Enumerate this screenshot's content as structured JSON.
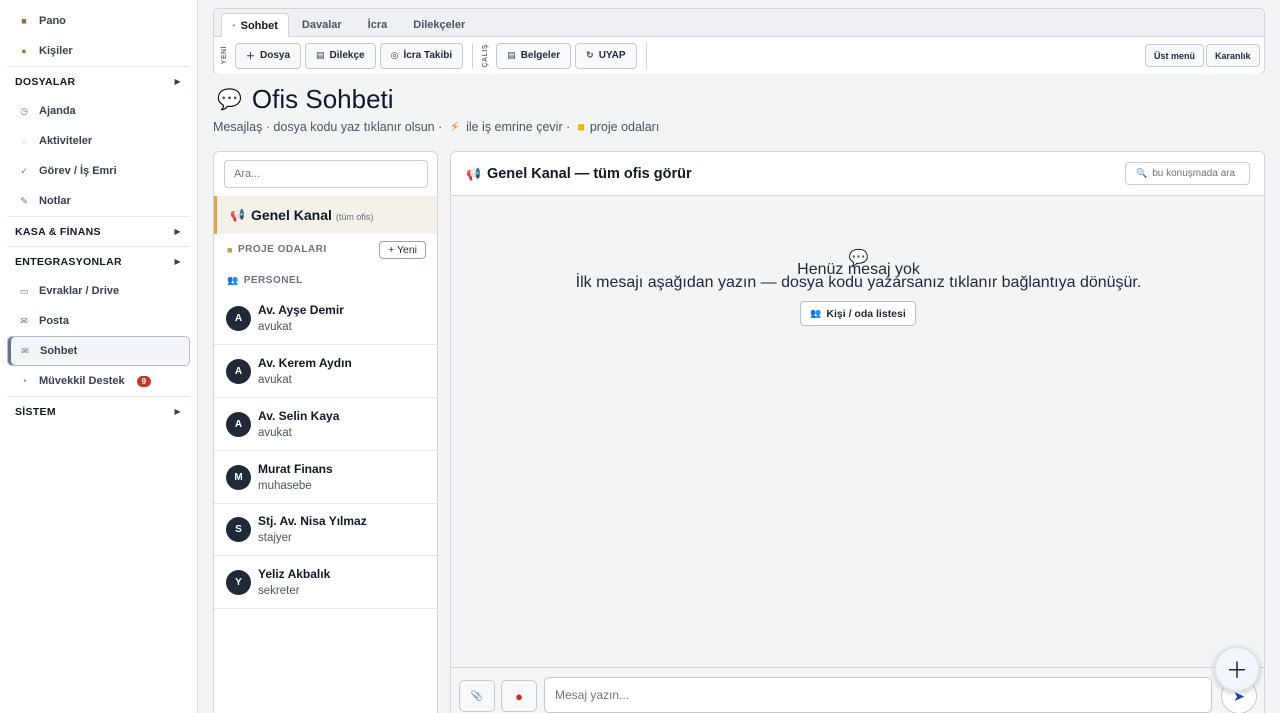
{
  "sidebar": {
    "pano": "Pano",
    "kisiler": "Kişiler",
    "dosyalar": "DOSYALAR",
    "ajanda": "Ajanda",
    "aktiviteler": "Aktiviteler",
    "gorev": "Görev / İş Emri",
    "notlar": "Notlar",
    "kasa": "KASA & FİNANS",
    "entegrasyonlar": "ENTEGRASYONLAR",
    "evraklar": "Evraklar / Drive",
    "posta": "Posta",
    "sohbet": "Sohbet",
    "muvekkil": "Müvekkil Destek",
    "muvekkil_badge": "9",
    "sistem": "SİSTEM"
  },
  "topbar": {
    "tabs": [
      "Sohbet",
      "Davalar",
      "İcra",
      "Dilekçeler"
    ],
    "yeni_label": "YENİ",
    "calis_label": "ÇALIŞ",
    "dosya": "Dosya",
    "dilekce": "Dilekçe",
    "icra_takibi": "İcra Takibi",
    "belgeler": "Belgeler",
    "uyap": "UYAP",
    "ust_menu": "Üst menü",
    "karanlik": "Karanlık"
  },
  "header": {
    "title": "Ofis Sohbeti",
    "sub1": "Mesajlaş · dosya kodu yaz tıklanır olsun ·",
    "sub2": "ile iş emrine çevir ·",
    "sub3": "proje odaları"
  },
  "left": {
    "search_placeholder": "Ara...",
    "genel_name": "Genel Kanal",
    "genel_small": "(tüm ofis)",
    "proje": "PROJE ODALARI",
    "yeni": "+ Yeni",
    "personel": "PERSONEL",
    "people": [
      {
        "initial": "A",
        "name": "Av. Ayşe Demir",
        "role": "avukat"
      },
      {
        "initial": "A",
        "name": "Av. Kerem Aydın",
        "role": "avukat"
      },
      {
        "initial": "A",
        "name": "Av. Selin Kaya",
        "role": "avukat"
      },
      {
        "initial": "M",
        "name": "Murat Finans",
        "role": "muhasebe"
      },
      {
        "initial": "S",
        "name": "Stj. Av. Nisa Yılmaz",
        "role": "stajyer"
      },
      {
        "initial": "Y",
        "name": "Yeliz Akbalık",
        "role": "sekreter"
      }
    ]
  },
  "chat": {
    "title": "Genel Kanal — tüm ofis görür",
    "search": "bu konuşmada ara",
    "empty_title": "Henüz mesaj yok",
    "empty_text": "İlk mesajı aşağıdan yazın — dosya kodu yazarsanız tıklanır bağlantıya dönüşür.",
    "list_button": "Kişi / oda listesi",
    "placeholder": "Mesaj yazın..."
  },
  "colors": {
    "accent": "#d6a55a",
    "badge": "#c0392b",
    "avatar": "#1f2937"
  }
}
